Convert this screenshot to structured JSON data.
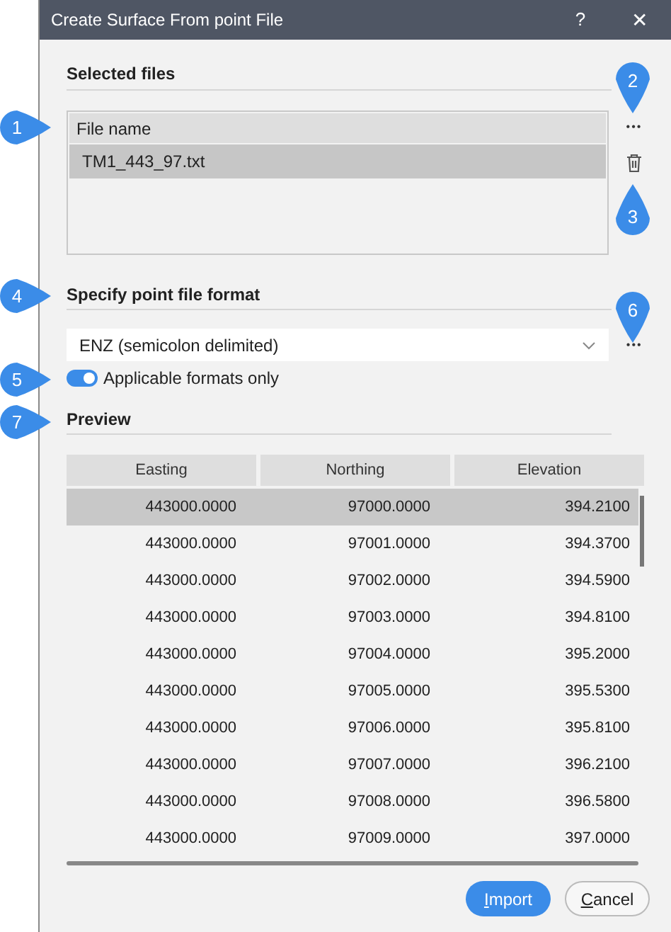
{
  "window": {
    "title": "Create Surface From point File",
    "help": "?",
    "close": "✕"
  },
  "selected_files": {
    "heading": "Selected files",
    "column": "File name",
    "files": [
      {
        "name": "TM1_443_97.txt",
        "selected": true
      }
    ],
    "browse": "•••"
  },
  "format": {
    "heading": "Specify point file format",
    "value": "ENZ (semicolon delimited)",
    "browse": "•••",
    "applicable_only": {
      "label": "Applicable formats only",
      "on": true
    }
  },
  "preview": {
    "heading": "Preview",
    "columns": [
      "Easting",
      "Northing",
      "Elevation"
    ],
    "rows": [
      {
        "cells": [
          "443000.0000",
          "97000.0000",
          "394.2100"
        ],
        "selected": true
      },
      {
        "cells": [
          "443000.0000",
          "97001.0000",
          "394.3700"
        ],
        "selected": false
      },
      {
        "cells": [
          "443000.0000",
          "97002.0000",
          "394.5900"
        ],
        "selected": false
      },
      {
        "cells": [
          "443000.0000",
          "97003.0000",
          "394.8100"
        ],
        "selected": false
      },
      {
        "cells": [
          "443000.0000",
          "97004.0000",
          "395.2000"
        ],
        "selected": false
      },
      {
        "cells": [
          "443000.0000",
          "97005.0000",
          "395.5300"
        ],
        "selected": false
      },
      {
        "cells": [
          "443000.0000",
          "97006.0000",
          "395.8100"
        ],
        "selected": false
      },
      {
        "cells": [
          "443000.0000",
          "97007.0000",
          "396.2100"
        ],
        "selected": false
      },
      {
        "cells": [
          "443000.0000",
          "97008.0000",
          "396.5800"
        ],
        "selected": false
      },
      {
        "cells": [
          "443000.0000",
          "97009.0000",
          "397.0000"
        ],
        "selected": false
      }
    ]
  },
  "buttons": [
    {
      "label": "Import",
      "kind": "primary"
    },
    {
      "label": "Cancel",
      "kind": "secondary"
    }
  ],
  "callouts": [
    {
      "number": "1",
      "kind": "right"
    },
    {
      "number": "2",
      "kind": "down"
    },
    {
      "number": "3",
      "kind": "up"
    },
    {
      "number": "4",
      "kind": "right"
    },
    {
      "number": "5",
      "kind": "right"
    },
    {
      "number": "6",
      "kind": "down"
    },
    {
      "number": "7",
      "kind": "right"
    }
  ]
}
